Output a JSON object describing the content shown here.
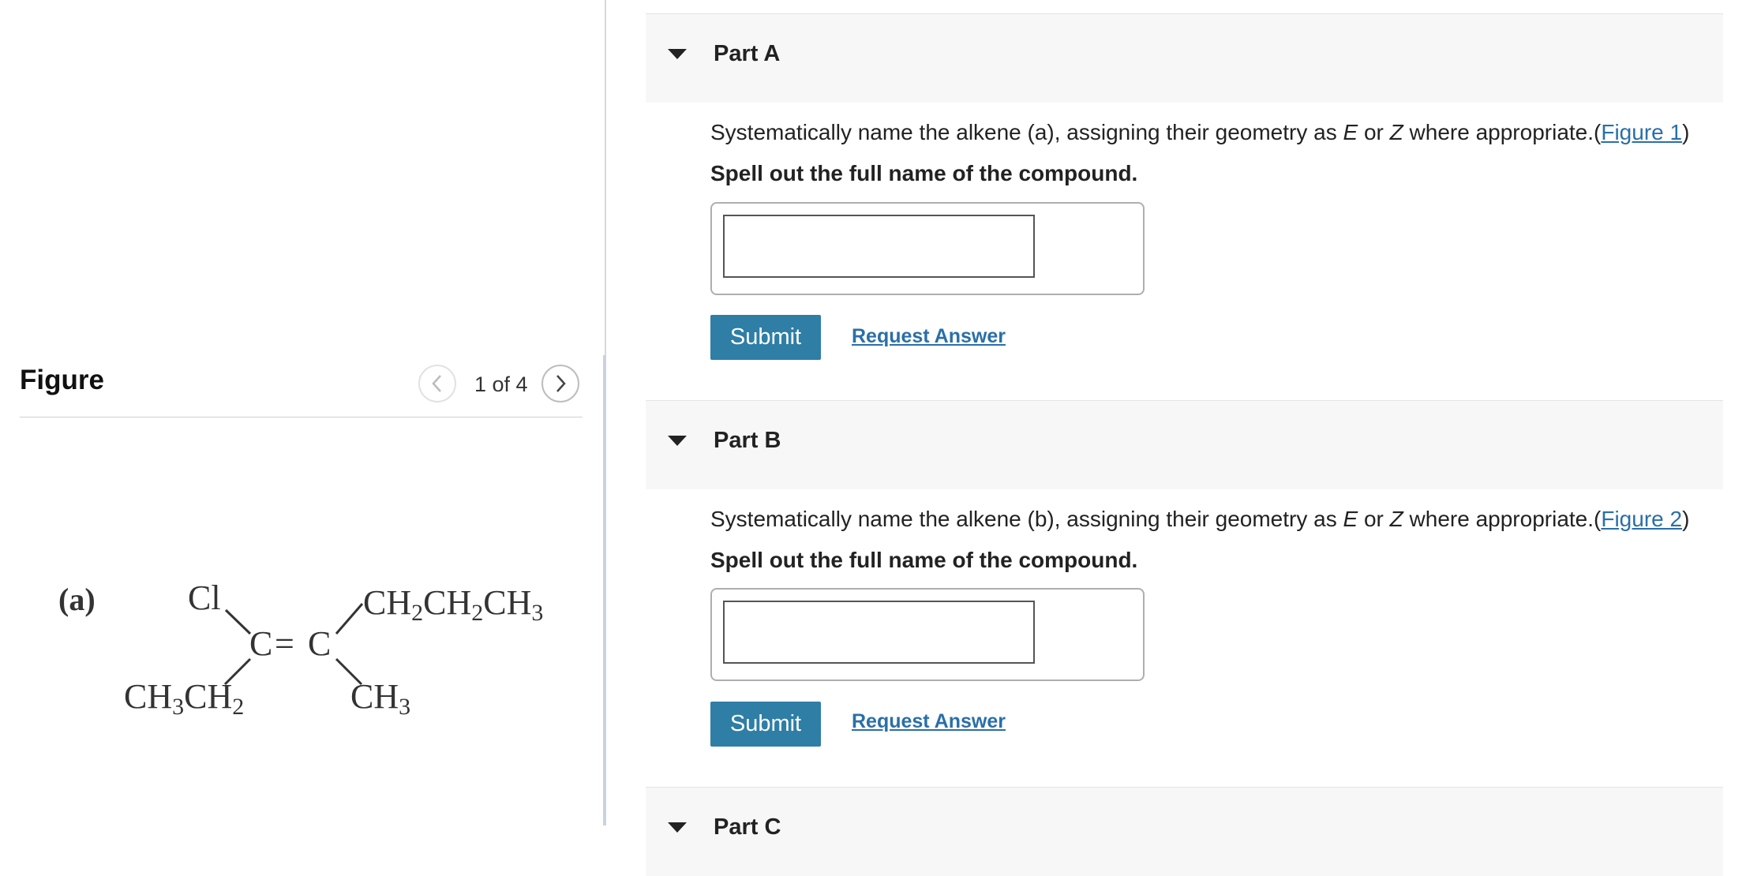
{
  "figure": {
    "title": "Figure",
    "pager": "1 of 4",
    "structure": {
      "label": "(a)",
      "atoms": {
        "cl": "Cl",
        "c_left": "C",
        "double_bond": "=",
        "c_right": "C",
        "ch": "CH",
        "sub2": "2",
        "sub3": "3"
      }
    }
  },
  "parts": [
    {
      "title": "Part A",
      "question_prefix": "Systematically name the alkene (a), assigning their geometry as ",
      "e": "E",
      "or": " or ",
      "z": "Z",
      "question_suffix": " where appropriate.(",
      "figure_link": "Figure 1",
      "close_paren": ")",
      "instruction": "Spell out the full name of the compound.",
      "answer_value": "",
      "submit": "Submit",
      "request": "Request Answer"
    },
    {
      "title": "Part B",
      "question_prefix": "Systematically name the alkene (b), assigning their geometry as ",
      "e": "E",
      "or": " or ",
      "z": "Z",
      "question_suffix": " where appropriate.(",
      "figure_link": "Figure 2",
      "close_paren": ")",
      "instruction": "Spell out the full name of the compound.",
      "answer_value": "",
      "submit": "Submit",
      "request": "Request Answer"
    },
    {
      "title": "Part C"
    }
  ],
  "icons": {
    "prev": "chevron-left-icon",
    "next": "chevron-right-icon",
    "collapse": "caret-down-icon"
  }
}
